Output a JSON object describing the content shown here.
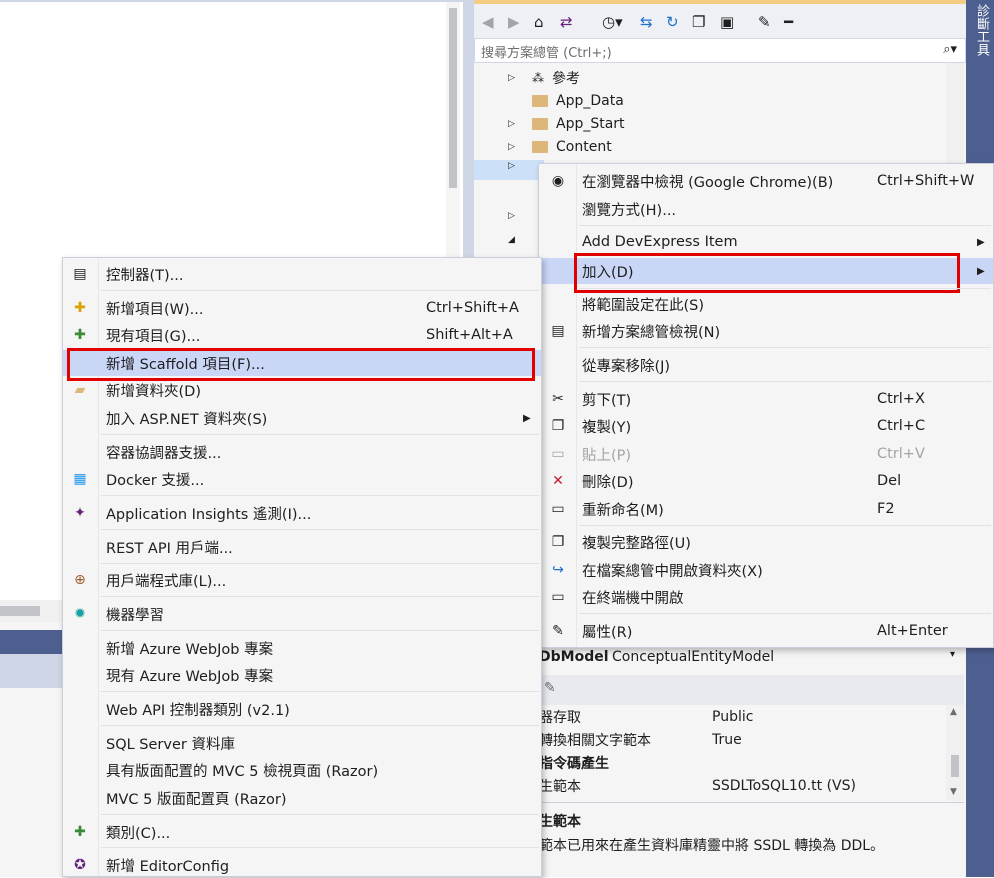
{
  "solution_explorer": {
    "search_placeholder": "搜尋方案總管 (Ctrl+;)",
    "tree": [
      {
        "label": "參考",
        "expand": "▷"
      },
      {
        "label": "App_Data",
        "expand": ""
      },
      {
        "label": "App_Start",
        "expand": "▷"
      },
      {
        "label": "Content",
        "expand": "▷"
      }
    ]
  },
  "properties": {
    "object_type": "DbModel",
    "object_value": "ConceptualEntityModel",
    "rows": [
      {
        "key": "器存取",
        "value": "Public"
      },
      {
        "key": "轉換相關文字範本",
        "value": "True"
      },
      {
        "key": "指令碼產生",
        "value": ""
      },
      {
        "key": "生範本",
        "value": "SSDLToSQL10.tt (VS)"
      }
    ],
    "desc_title": "生範本",
    "desc_text": "範本已用來在產生資料庫精靈中將 SSDL 轉換為 DDL。"
  },
  "side_tab": {
    "label": "診斷工具"
  },
  "context_menu": {
    "items": [
      {
        "label": "在瀏覽器中檢視 (Google Chrome)(B)",
        "shortcut": "Ctrl+Shift+W",
        "icon": "browser-icon"
      },
      {
        "label": "瀏覽方式(H)...",
        "shortcut": ""
      },
      {
        "label": "Add DevExpress Item",
        "shortcut": "",
        "submenu": true
      },
      {
        "label": "加入(D)",
        "shortcut": "",
        "submenu": true
      },
      {
        "label": "將範圍設定在此(S)",
        "shortcut": ""
      },
      {
        "label": "新增方案總管檢視(N)",
        "shortcut": "",
        "icon": "new-view-icon"
      },
      {
        "label": "從專案移除(J)",
        "shortcut": ""
      },
      {
        "label": "剪下(T)",
        "shortcut": "Ctrl+X",
        "icon": "cut-icon"
      },
      {
        "label": "複製(Y)",
        "shortcut": "Ctrl+C",
        "icon": "copy-icon"
      },
      {
        "label": "貼上(P)",
        "shortcut": "Ctrl+V",
        "icon": "paste-icon"
      },
      {
        "label": "刪除(D)",
        "shortcut": "Del",
        "icon": "delete-icon"
      },
      {
        "label": "重新命名(M)",
        "shortcut": "F2",
        "icon": "rename-icon"
      },
      {
        "label": "複製完整路徑(U)",
        "shortcut": "",
        "icon": "copy-path-icon"
      },
      {
        "label": "在檔案總管中開啟資料夾(X)",
        "shortcut": "",
        "icon": "open-folder-icon"
      },
      {
        "label": "在終端機中開啟",
        "shortcut": "",
        "icon": "terminal-icon"
      },
      {
        "label": "屬性(R)",
        "shortcut": "Alt+Enter",
        "icon": "wrench-icon"
      }
    ]
  },
  "add_submenu": {
    "items": [
      {
        "label": "控制器(T)...",
        "shortcut": ""
      },
      {
        "label": "新增項目(W)...",
        "shortcut": "Ctrl+Shift+A"
      },
      {
        "label": "現有項目(G)...",
        "shortcut": "Shift+Alt+A"
      },
      {
        "label": "新增 Scaffold 項目(F)...",
        "shortcut": ""
      },
      {
        "label": "新增資料夾(D)",
        "shortcut": ""
      },
      {
        "label": "加入 ASP.NET 資料夾(S)",
        "shortcut": ""
      },
      {
        "label": "容器協調器支援...",
        "shortcut": ""
      },
      {
        "label": "Docker 支援...",
        "shortcut": ""
      },
      {
        "label": "Application Insights 遙測(I)...",
        "shortcut": ""
      },
      {
        "label": "REST API 用戶端...",
        "shortcut": ""
      },
      {
        "label": "用戶端程式庫(L)...",
        "shortcut": ""
      },
      {
        "label": "機器學習",
        "shortcut": ""
      },
      {
        "label": "新增 Azure WebJob 專案",
        "shortcut": ""
      },
      {
        "label": "現有 Azure WebJob 專案",
        "shortcut": ""
      },
      {
        "label": "Web API 控制器類別 (v2.1)",
        "shortcut": ""
      },
      {
        "label": "SQL Server 資料庫",
        "shortcut": ""
      },
      {
        "label": "具有版面配置的 MVC 5 檢視頁面 (Razor)",
        "shortcut": ""
      },
      {
        "label": "MVC 5 版面配置頁 (Razor)",
        "shortcut": ""
      },
      {
        "label": "類別(C)...",
        "shortcut": ""
      },
      {
        "label": "新增 EditorConfig",
        "shortcut": ""
      }
    ]
  }
}
